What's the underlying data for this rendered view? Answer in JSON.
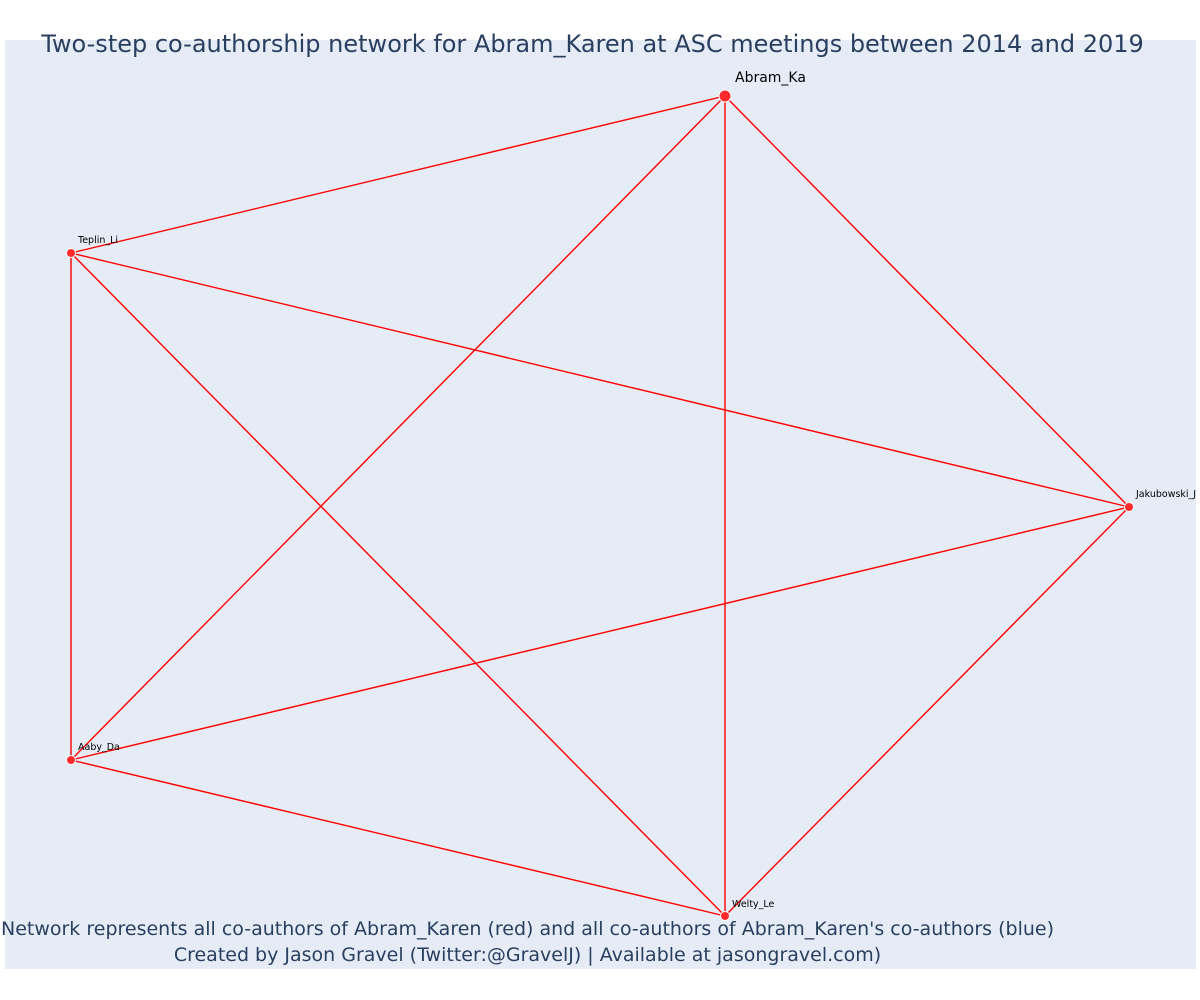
{
  "title": "Two-step co-authorship network for Abram_Karen at ASC meetings between 2014 and 2019",
  "footer": {
    "line1": "Network represents all co-authors of Abram_Karen (red) and all co-authors of Abram_Karen's co-authors (blue)",
    "line2": "Created by Jason Gravel (Twitter:@GravelJ) | Available at jasongravel.com)"
  },
  "colors": {
    "edge": "#ff0000",
    "node": "#ff2a2a",
    "background": "#e5ecf6",
    "text": "#2a3f5f"
  },
  "network": {
    "nodes": [
      {
        "id": "Abram_Ka",
        "label": "Abram_Ka",
        "focal": true
      },
      {
        "id": "Teplin_Li",
        "label": "Teplin_Li",
        "focal": false
      },
      {
        "id": "Jakubowski_J",
        "label": "Jakubowski_J",
        "focal": false
      },
      {
        "id": "Aaby_Da",
        "label": "Aaby_Da",
        "focal": false
      },
      {
        "id": "Welty_Le",
        "label": "Welty_Le",
        "focal": false
      }
    ],
    "edges": [
      [
        "Abram_Ka",
        "Teplin_Li"
      ],
      [
        "Abram_Ka",
        "Jakubowski_J"
      ],
      [
        "Abram_Ka",
        "Aaby_Da"
      ],
      [
        "Abram_Ka",
        "Welty_Le"
      ],
      [
        "Teplin_Li",
        "Jakubowski_J"
      ],
      [
        "Teplin_Li",
        "Aaby_Da"
      ],
      [
        "Teplin_Li",
        "Welty_Le"
      ],
      [
        "Jakubowski_J",
        "Aaby_Da"
      ],
      [
        "Jakubowski_J",
        "Welty_Le"
      ],
      [
        "Aaby_Da",
        "Welty_Le"
      ]
    ]
  }
}
